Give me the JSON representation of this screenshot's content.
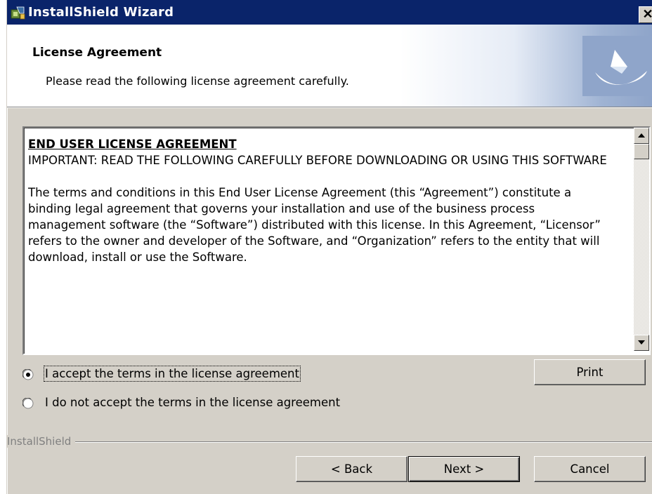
{
  "window": {
    "title": "InstallShield Wizard",
    "close_glyph": "✕",
    "icon": "installer-icon"
  },
  "banner": {
    "heading": "License Agreement",
    "subheading": "Please read the following license agreement carefully.",
    "logo_icon": "installshield-logo-icon"
  },
  "license": {
    "title": "END USER LICENSE AGREEMENT",
    "important": "IMPORTANT: READ THE FOLLOWING CAREFULLY BEFORE DOWNLOADING OR USING THIS SOFTWARE",
    "body": "The terms and conditions in this End User License Agreement (this “Agreement”) constitute a binding legal agreement that governs your installation and use of the business process management software (the “Software”) distributed with this license. In this Agreement, “Licensor” refers to the owner and developer of the Software, and “Organization” refers to the entity that will download, install or use the Software."
  },
  "options": {
    "accept_label": "I accept the terms in the license agreement",
    "decline_label": "I do not accept the terms in the license agreement",
    "selected": "accept"
  },
  "buttons": {
    "print": "Print",
    "back": "< Back",
    "next": "Next >",
    "cancel": "Cancel"
  },
  "footer": {
    "brand": "InstallShield"
  },
  "colors": {
    "title_bar": "#0a246a",
    "dialog_face": "#d4d0c8"
  }
}
